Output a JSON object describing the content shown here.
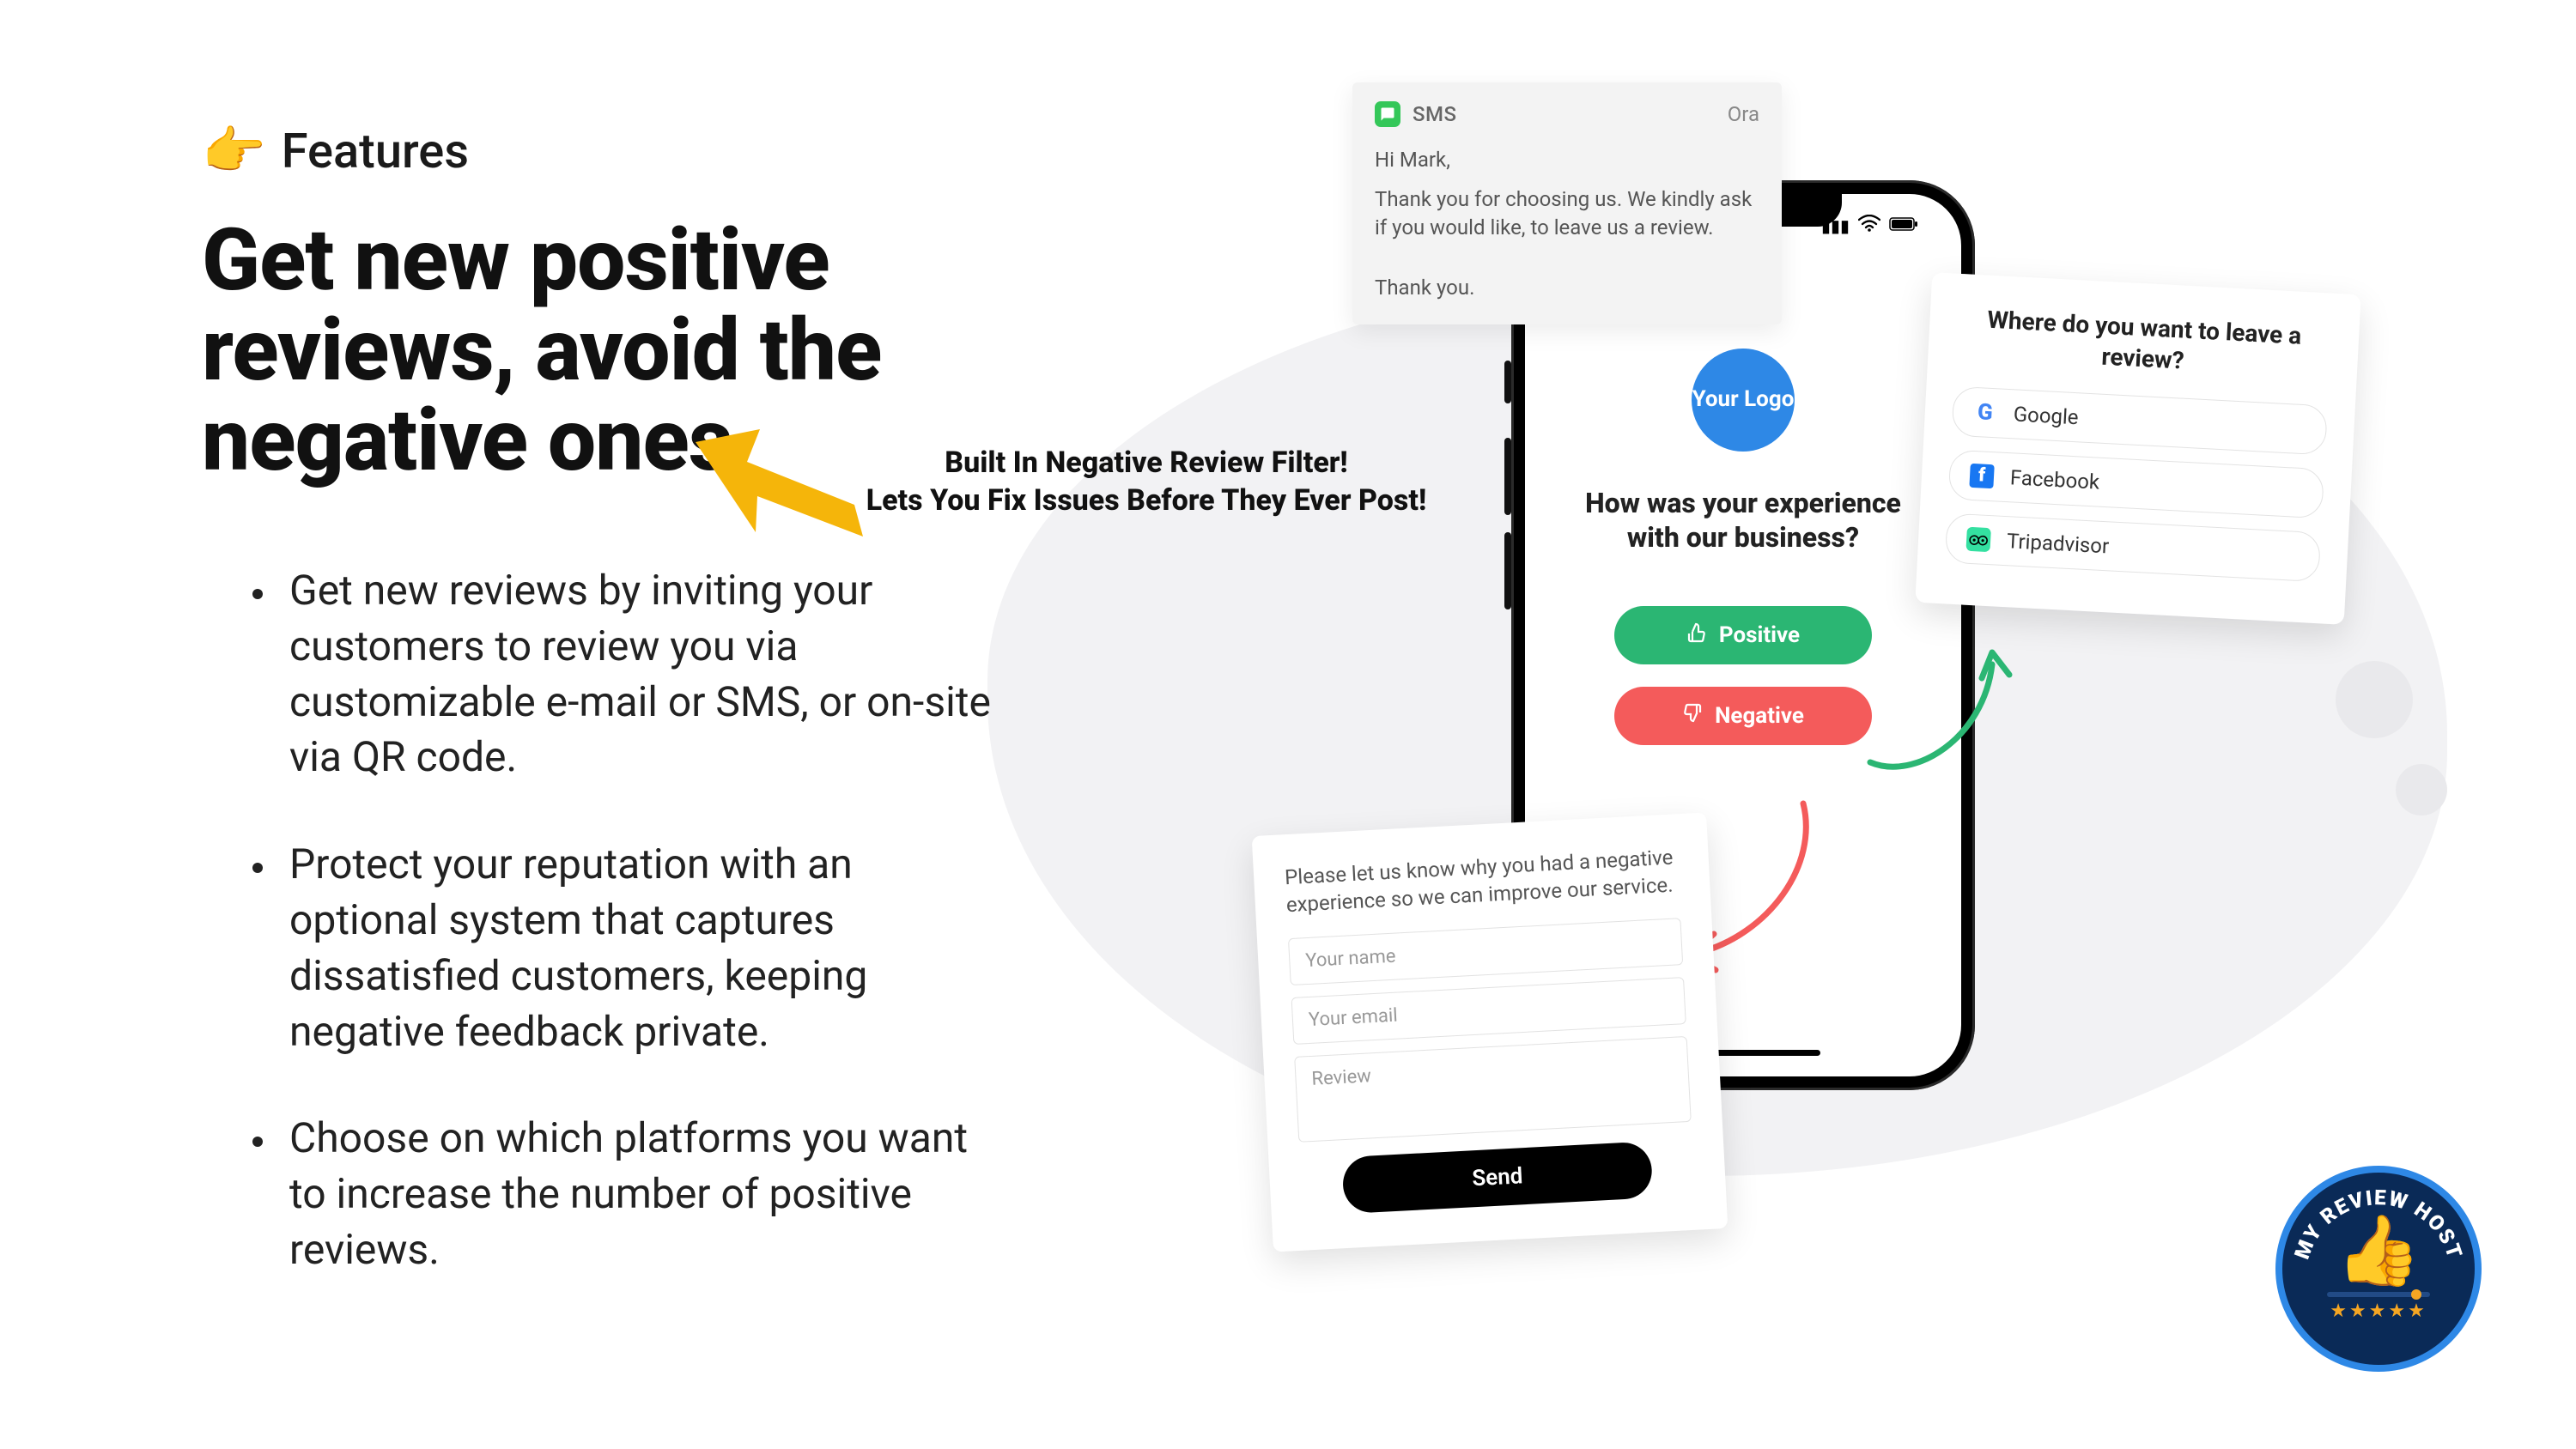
{
  "features_label": "Features",
  "main_heading": "Get new positive reviews, avoid the negative ones",
  "bullets": [
    "Get new reviews by inviting your customers to review you via customizable e-mail or SMS, or on-site via QR code.",
    "Protect your reputation with an optional system that captures dissatisfied customers, keeping negative feedback private.",
    "Choose on which platforms you want to increase the number of positive reviews."
  ],
  "arrow_caption_line1": "Built In Negative Review Filter!",
  "arrow_caption_line2": "Lets You Fix Issues Before They Ever Post!",
  "sms": {
    "app": "SMS",
    "time": "Ora",
    "greeting": "Hi Mark,",
    "body": "Thank you for choosing us. We kindly ask if you would like, to leave us a review.",
    "signoff": "Thank you."
  },
  "phone": {
    "logo_text": "Your Logo",
    "question": "How was your experience with our business?",
    "positive_label": "Positive",
    "negative_label": "Negative"
  },
  "site_card": {
    "title": "Where do you want to leave a review?",
    "options": [
      "Google",
      "Facebook",
      "Tripadvisor"
    ]
  },
  "form_card": {
    "title": "Please let us know why you had a negative experience so we can improve our service.",
    "name_placeholder": "Your name",
    "email_placeholder": "Your email",
    "review_placeholder": "Review",
    "send_label": "Send"
  },
  "badge": {
    "text": "MY REVIEW HOST",
    "stars": "★★★★★"
  }
}
